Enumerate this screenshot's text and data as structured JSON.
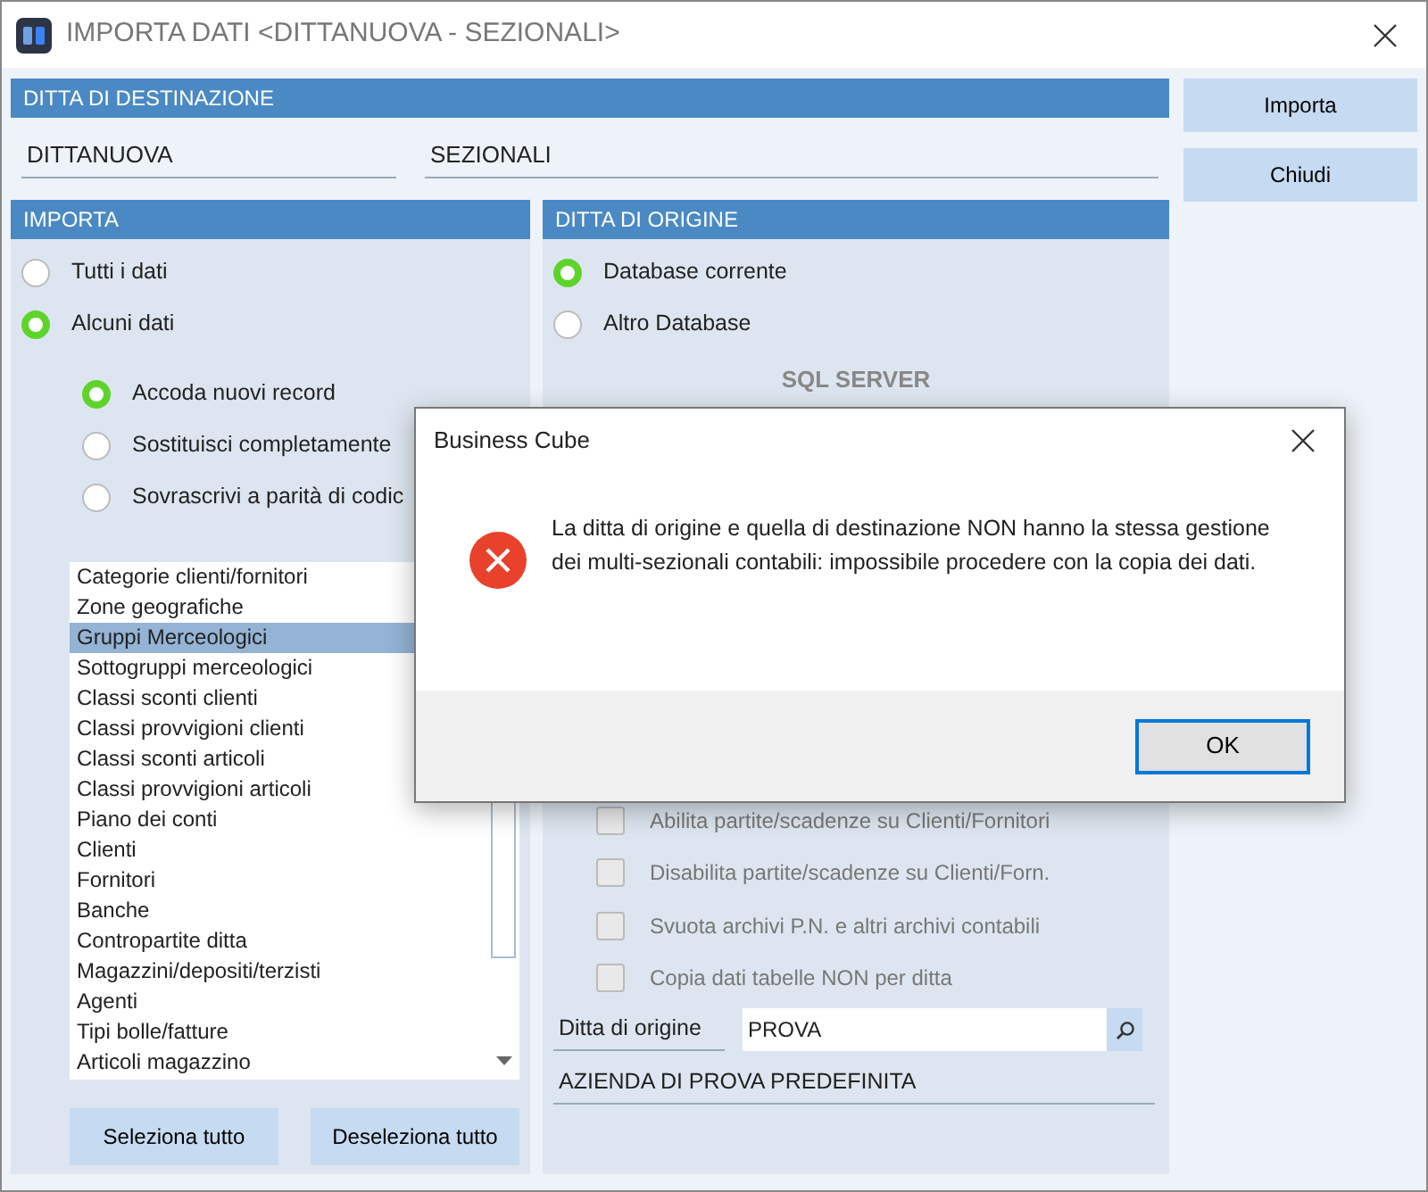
{
  "window": {
    "title": "IMPORTA DATI <DITTANUOVA - SEZIONALI>"
  },
  "destination": {
    "header": "DITTA DI DESTINAZIONE",
    "code": "DITTANUOVA",
    "name": "SEZIONALI"
  },
  "import": {
    "header": "IMPORTA",
    "scope": [
      {
        "label": "Tutti i dati",
        "selected": false
      },
      {
        "label": "Alcuni dati",
        "selected": true
      }
    ],
    "mode": [
      {
        "label": "Accoda nuovi record",
        "selected": true
      },
      {
        "label": "Sostituisci completamente",
        "selected": false
      },
      {
        "label": "Sovrascrivi a parità di codic",
        "selected": false
      }
    ],
    "items": [
      {
        "label": "Categorie clienti/fornitori",
        "selected": false
      },
      {
        "label": "Zone geografiche",
        "selected": false
      },
      {
        "label": "Gruppi Merceologici",
        "selected": true
      },
      {
        "label": "Sottogruppi merceologici",
        "selected": false
      },
      {
        "label": "Classi sconti clienti",
        "selected": false
      },
      {
        "label": "Classi provvigioni clienti",
        "selected": false
      },
      {
        "label": "Classi sconti articoli",
        "selected": false
      },
      {
        "label": "Classi provvigioni articoli",
        "selected": false
      },
      {
        "label": "Piano dei conti",
        "selected": false
      },
      {
        "label": "Clienti",
        "selected": false
      },
      {
        "label": "Fornitori",
        "selected": false
      },
      {
        "label": "Banche",
        "selected": false
      },
      {
        "label": "Contropartite ditta",
        "selected": false
      },
      {
        "label": "Magazzini/depositi/terzisti",
        "selected": false
      },
      {
        "label": "Agenti",
        "selected": false
      },
      {
        "label": "Tipi bolle/fatture",
        "selected": false
      },
      {
        "label": "Articoli magazzino",
        "selected": false
      }
    ],
    "buttons": [
      "Seleziona tutto",
      "Deseleziona tutto"
    ]
  },
  "origin": {
    "header": "DITTA DI ORIGINE",
    "source": [
      {
        "label": "Database corrente",
        "selected": true
      },
      {
        "label": "Altro Database",
        "selected": false
      }
    ],
    "server": "SQL SERVER",
    "options": [
      {
        "label": "Abilita partite/scadenze su Clienti/Fornitori",
        "checked": false,
        "disabled": true
      },
      {
        "label": "Disabilita partite/scadenze su Clienti/Forn.",
        "checked": false,
        "disabled": true
      },
      {
        "label": "Svuota archivi P.N. e altri archivi contabili",
        "checked": false,
        "disabled": true
      },
      {
        "label": "Copia dati tabelle NON per ditta",
        "checked": false,
        "disabled": true
      }
    ],
    "company_label": "Ditta di origine",
    "company_code": "PROVA",
    "company_name": "AZIENDA DI PROVA PREDEFINITA"
  },
  "actions": [
    "Importa",
    "Chiudi"
  ],
  "dialog": {
    "title": "Business Cube",
    "message": "La ditta di origine e quella di destinazione NON hanno la stessa gestione dei multi-sezionali contabili: impossibile procedere con la copia dei dati.",
    "button": "OK"
  }
}
